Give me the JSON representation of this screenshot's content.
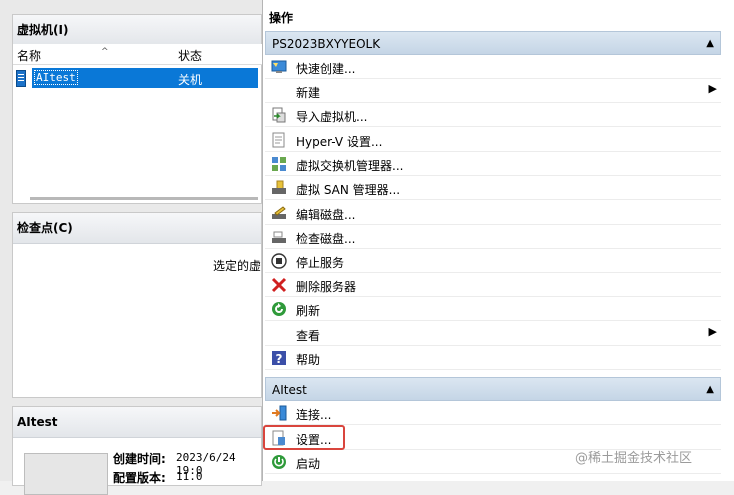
{
  "left": {
    "vm_panel": {
      "title": "虚拟机(I)",
      "columns": [
        "名称",
        "状态"
      ],
      "rows": [
        {
          "name": "AItest",
          "state": "关机"
        }
      ]
    },
    "checkpoint_panel": {
      "title": "检查点(C)",
      "message": "选定的虚"
    },
    "details_panel": {
      "title": "AItest",
      "created_label": "创建时间:",
      "created_value": "2023/6/24 19:0",
      "config_label": "配置版本:",
      "config_value": "11.0"
    }
  },
  "actions": {
    "title": "操作",
    "server_group": {
      "label": "PS2023BXYYEOLK",
      "items": [
        {
          "label": "快速创建...",
          "icon": "quick-create-icon"
        },
        {
          "label": "新建",
          "icon": "",
          "submenu": true
        },
        {
          "label": "导入虚拟机...",
          "icon": "import-icon"
        },
        {
          "label": "Hyper-V 设置...",
          "icon": "hyperv-settings-icon"
        },
        {
          "label": "虚拟交换机管理器...",
          "icon": "switch-manager-icon"
        },
        {
          "label": "虚拟 SAN 管理器...",
          "icon": "san-manager-icon"
        },
        {
          "label": "编辑磁盘...",
          "icon": "edit-disk-icon"
        },
        {
          "label": "检查磁盘...",
          "icon": "inspect-disk-icon"
        },
        {
          "label": "停止服务",
          "icon": "stop-icon"
        },
        {
          "label": "删除服务器",
          "icon": "delete-icon"
        },
        {
          "label": "刷新",
          "icon": "refresh-icon"
        },
        {
          "label": "查看",
          "icon": "",
          "submenu": true
        },
        {
          "label": "帮助",
          "icon": "help-icon"
        }
      ]
    },
    "vm_group": {
      "label": "AItest",
      "items": [
        {
          "label": "连接...",
          "icon": "connect-icon"
        },
        {
          "label": "设置...",
          "icon": "settings-icon"
        },
        {
          "label": "启动",
          "icon": "start-icon"
        }
      ]
    }
  },
  "watermark": "@稀土掘金技术社区",
  "colors": {
    "selection": "#0a78d7",
    "highlight_border": "#d9453d",
    "group_bg": "#c5d5e6"
  }
}
